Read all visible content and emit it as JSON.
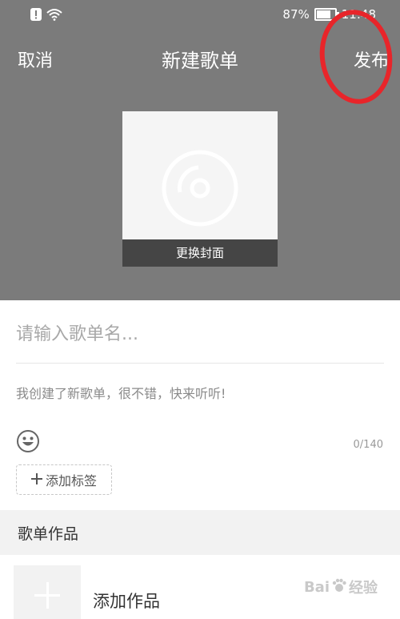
{
  "status_bar": {
    "battery_percent": "87%",
    "time": "11:48",
    "icons": [
      "alert-icon",
      "wifi-icon",
      "battery-icon"
    ]
  },
  "nav": {
    "cancel_label": "取消",
    "title": "新建歌单",
    "publish_label": "发布"
  },
  "cover": {
    "icon": "disc-icon",
    "change_label": "更换封面"
  },
  "form": {
    "name_placeholder": "请输入歌单名...",
    "desc_placeholder": "我创建了新歌单，很不错，快来听听!",
    "emoji_icon": "smiley-icon",
    "counter": "0/140",
    "add_tag_label": "添加标签"
  },
  "works": {
    "section_title": "歌单作品",
    "add_label": "添加作品"
  },
  "watermark": {
    "text": "Bai",
    "suffix": "经验"
  },
  "colors": {
    "header_bg": "#7b7b7b",
    "annotation": "#e8252a"
  }
}
